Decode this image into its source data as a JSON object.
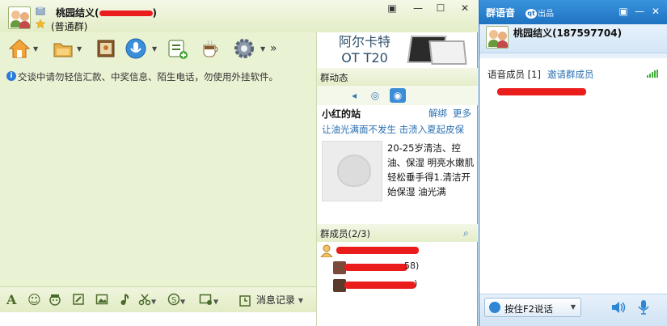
{
  "chat_window": {
    "group_name": "桃园结义(",
    "group_name_suffix": ")",
    "group_type": "(普通群)",
    "window_controls": {
      "menu": "▣",
      "minimize": "—",
      "maximize": "☐",
      "close": "✕"
    },
    "toolbar": {
      "more": "»"
    },
    "ad": {
      "line1": "阿尔卡特",
      "line2": "OT T20"
    },
    "notice": "交谈中请勿轻信汇款、中奖信息、陌生电话，勿使用外挂软件。",
    "input_toolbar": {
      "font": "A",
      "emoji": "☺",
      "message_record": "消息记录"
    }
  },
  "side": {
    "group_feed_title": "群动态",
    "site_title": "小红的站",
    "unbind": "解绑",
    "more": "更多",
    "tagline": "让油光满面不发生  击溃入夏起皮保",
    "description": "20-25岁清洁、控油、保湿  明亮水嫩肌轻松垂手得1.清洁开始保湿  油光满",
    "members_title": "群成员(2/3)",
    "member_suffixes": [
      "",
      "58)",
      ")"
    ]
  },
  "voice_window": {
    "title": "群语音",
    "brand_mark": "qt",
    "brand_suffix": "出品",
    "group_name": "桃园结义(187597704)",
    "voice_members": "语音成员 [1]",
    "invite": "邀请群成员",
    "push_to_talk": "按住F2说话",
    "window_controls": {
      "menu": "▣",
      "minimize": "—",
      "close": "✕"
    }
  },
  "colors": {
    "chat_bg": "#eaf2d4",
    "voice_title": "#2a7fcb",
    "link": "#2a6fb1",
    "redaction": "#ea1c1c"
  },
  "icons": {
    "toolbar": [
      "home-icon",
      "folder-icon",
      "album-icon",
      "voice-icon",
      "note-add-icon",
      "coffee-icon",
      "gear-icon"
    ],
    "input_toolbar": [
      "font-icon",
      "emoji-icon",
      "funny-face-icon",
      "edit-icon",
      "image-icon",
      "music-icon",
      "scissors-icon",
      "s-icon",
      "screen-icon",
      "history-icon"
    ]
  }
}
